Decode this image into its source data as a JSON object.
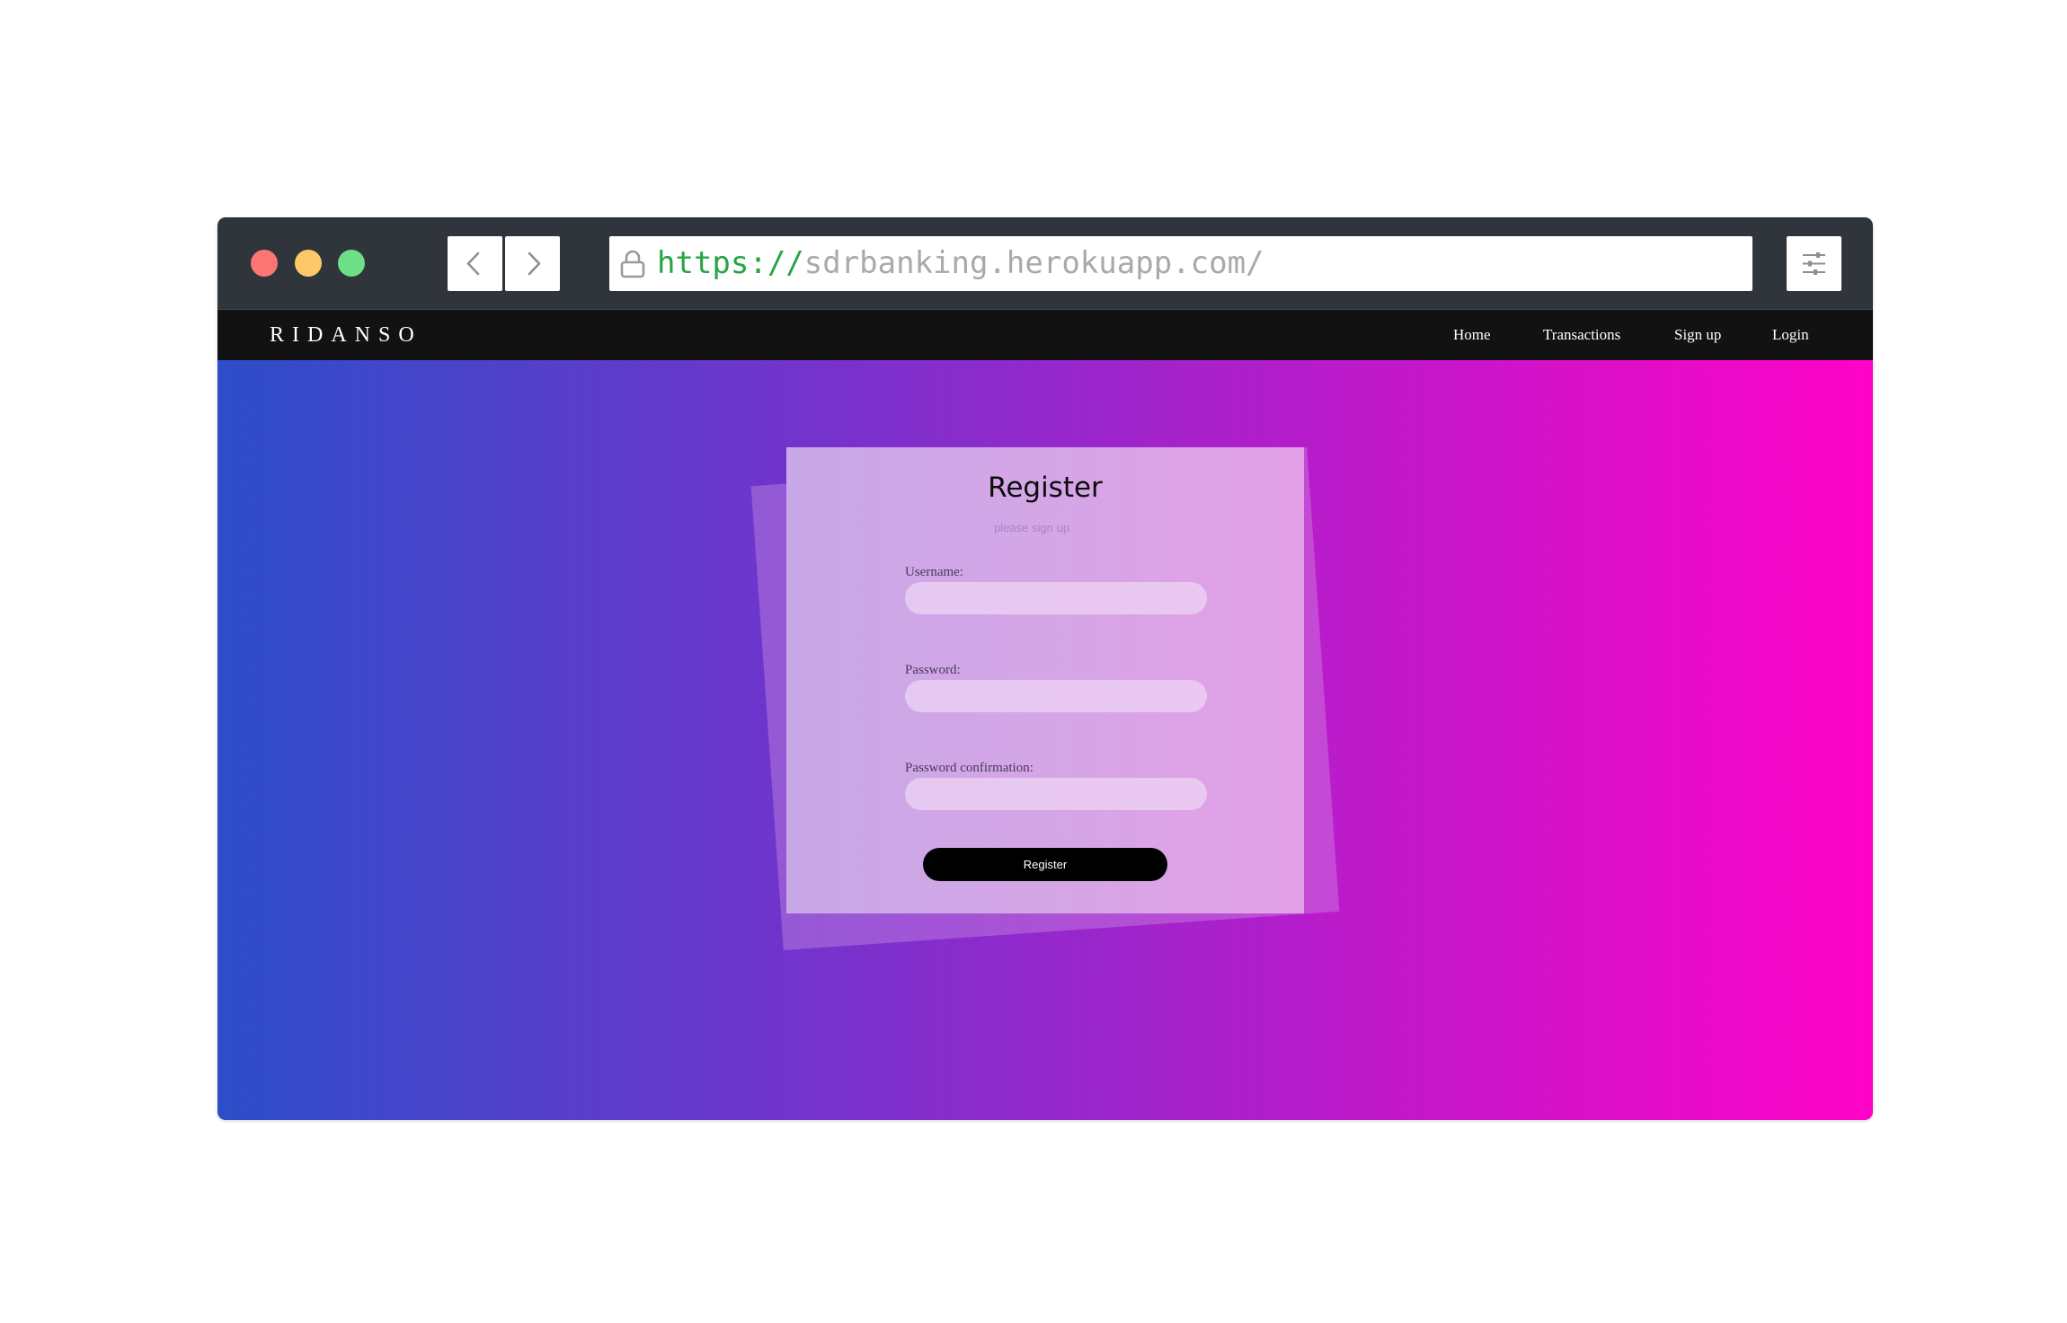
{
  "browser": {
    "url_protocol": "https://",
    "url_host": "sdrbanking.herokuapp.com/",
    "traffic_lights": {
      "close": "#fc7676",
      "minimize": "#fdc968",
      "maximize": "#6cdf87"
    },
    "icons": {
      "back": "chevron-left-icon",
      "forward": "chevron-right-icon",
      "lock": "lock-icon",
      "menu": "sliders-icon"
    }
  },
  "navbar": {
    "brand": "RIDANSO",
    "links": [
      "Home",
      "Transactions",
      "Sign up",
      "Login"
    ]
  },
  "form": {
    "title": "Register",
    "subtitle": "please sign up",
    "fields": [
      {
        "label": "Username:",
        "value": ""
      },
      {
        "label": "Password:",
        "value": ""
      },
      {
        "label": "Password confirmation:",
        "value": ""
      }
    ],
    "submit_label": "Register"
  },
  "colors": {
    "gradient_start": "#2d4ec9",
    "gradient_end": "#ff03c7",
    "navbar_bg": "#121212",
    "chrome_bg": "#2f353a"
  }
}
